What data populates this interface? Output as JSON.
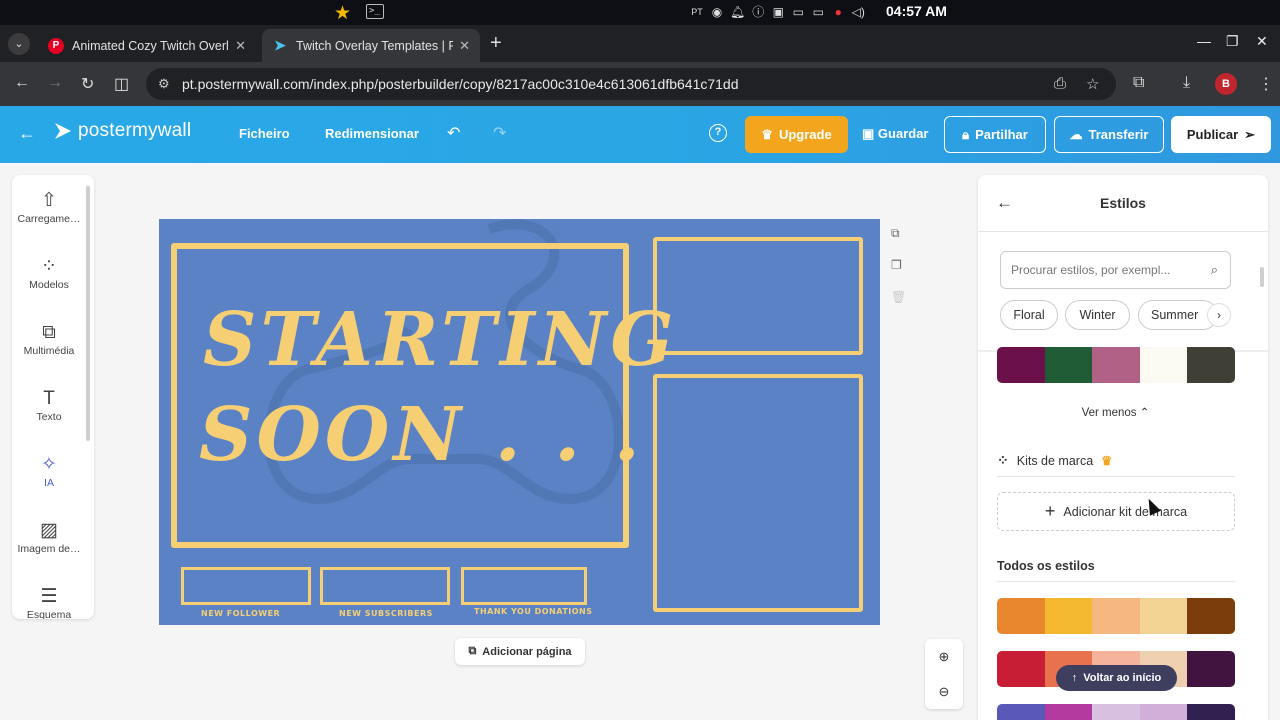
{
  "os": {
    "clock": "04:57 AM",
    "lang": "PT"
  },
  "browser": {
    "tabs": [
      {
        "title": "Animated Cozy Twitch Overl",
        "favicon": "P"
      },
      {
        "title": "Twitch Overlay Templates | P"
      }
    ],
    "url": "pt.postermywall.com/index.php/posterbuilder/copy/8217ac00c310e4c613061dfb641c71dd",
    "profile_initial": "B"
  },
  "app": {
    "logo_text": "postermywall",
    "menu": {
      "file": "Ficheiro",
      "resize": "Redimensionar"
    },
    "help": "?",
    "upgrade": "Upgrade",
    "save": "Guardar",
    "share": "Partilhar",
    "download": "Transferir",
    "publish": "Publicar"
  },
  "tools": [
    {
      "label": "Carregame…",
      "icon": "upload-icon"
    },
    {
      "label": "Modelos",
      "icon": "templates-icon"
    },
    {
      "label": "Multimédia",
      "icon": "media-icon"
    },
    {
      "label": "Texto",
      "icon": "text-icon"
    },
    {
      "label": "IA",
      "icon": "ai-sparkle-icon"
    },
    {
      "label": "Imagem de…",
      "icon": "background-icon"
    },
    {
      "label": "Esquema",
      "icon": "layout-icon"
    }
  ],
  "canvas": {
    "line1": "STARTING",
    "line2": "SOON . . .",
    "labels": [
      "NEW FOLLOWER",
      "NEW SUBSCRIBERS",
      "THANK YOU DONATIONS"
    ],
    "background": "#5a82c4",
    "accent": "#f6cf75"
  },
  "add_page": "Adicionar página",
  "styles_panel": {
    "title": "Estilos",
    "search_placeholder": "Procurar estilos, por exempl...",
    "chips": [
      "Floral",
      "Winter",
      "Summer"
    ],
    "top_palette": [
      "#6b1048",
      "#1f5b34",
      "#b06185",
      "#fbfaf2",
      "#3f3f36"
    ],
    "see_less": "Ver menos",
    "brand_kits": "Kits de marca",
    "add_brand_kit": "Adicionar kit de marca",
    "all_styles": "Todos os estilos",
    "palettes": [
      [
        "#e8872d",
        "#f3b82f",
        "#f5b67f",
        "#f2d394",
        "#7a3d0b"
      ],
      [
        "#c81e35",
        "#e8714e",
        "#f4b39a",
        "#eed0b0",
        "#40143e"
      ]
    ],
    "back_to_top": "Voltar ao início"
  }
}
